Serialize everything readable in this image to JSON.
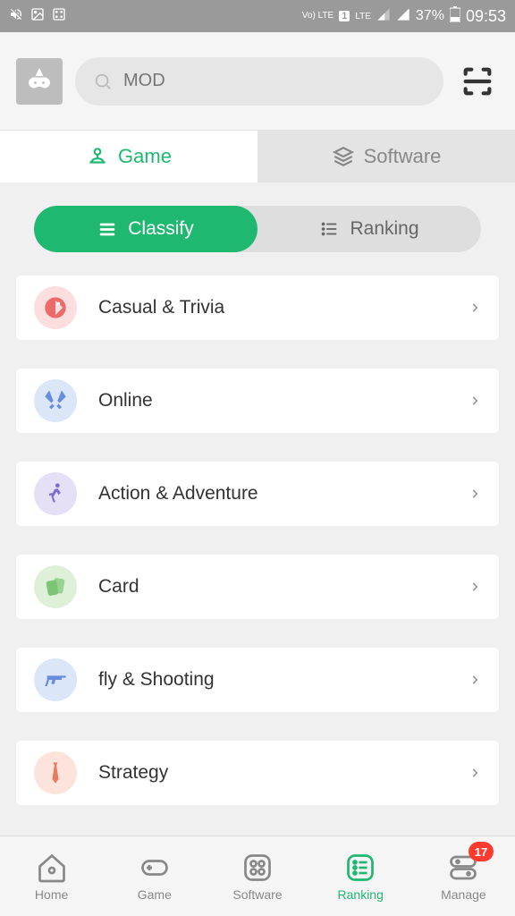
{
  "status": {
    "volte": "Vo) LTE",
    "sim": "1",
    "lte": "LTE",
    "battery": "37%",
    "time": "09:53"
  },
  "search": {
    "placeholder": "MOD"
  },
  "top_tabs": [
    {
      "label": "Game",
      "active": true
    },
    {
      "label": "Software",
      "active": false
    }
  ],
  "sub_tabs": [
    {
      "label": "Classify",
      "active": true
    },
    {
      "label": "Ranking",
      "active": false
    }
  ],
  "categories": [
    {
      "label": "Casual & Trivia",
      "icon": "pacman",
      "bg": "#fcdede",
      "fg": "#ec6a6a"
    },
    {
      "label": "Online",
      "icon": "swords",
      "bg": "#dbe6f9",
      "fg": "#6a8cdc"
    },
    {
      "label": "Action & Adventure",
      "icon": "runner",
      "bg": "#e5e0f5",
      "fg": "#7a6dd0"
    },
    {
      "label": "Card",
      "icon": "cards",
      "bg": "#dff0d8",
      "fg": "#7cc576"
    },
    {
      "label": "fly & Shooting",
      "icon": "gun",
      "bg": "#dbe6f9",
      "fg": "#6a8cdc"
    },
    {
      "label": "Strategy",
      "icon": "tie",
      "bg": "#fce3dc",
      "fg": "#e87a5e"
    }
  ],
  "bottom_nav": [
    {
      "label": "Home"
    },
    {
      "label": "Game"
    },
    {
      "label": "Software"
    },
    {
      "label": "Ranking",
      "active": true
    },
    {
      "label": "Manage",
      "badge": "17"
    }
  ]
}
